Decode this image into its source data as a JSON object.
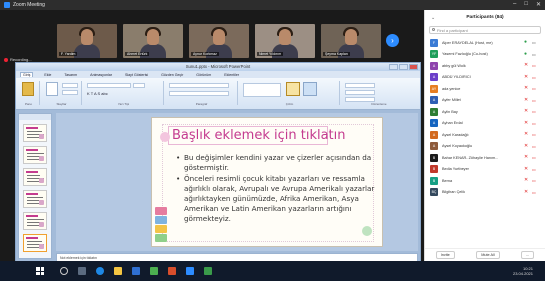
{
  "zoom": {
    "window_title": "Zoom Meeting",
    "recording_label": "Recording...",
    "video_tiles": [
      {
        "name": "F. Yardim",
        "bg": "#6d5a4a"
      },
      {
        "name": "Ahmet Ertürk",
        "bg": "#8a7d6c"
      },
      {
        "name": "Aynur Korkmaz",
        "bg": "#7b6a5b"
      },
      {
        "name": "Nimet Yıldırım",
        "bg": "#9c8f84"
      },
      {
        "name": "Şeyma Kaplan",
        "bg": "#6f6356"
      }
    ]
  },
  "ppt": {
    "window_title": "Sunu1.pptx - Microsoft PowerPoint",
    "tabs": [
      "Giriş",
      "Ekle",
      "Tasarım",
      "Animasyonlar",
      "Slayt Gösterisi",
      "Gözden Geçir",
      "Görünüm",
      "Eklentiler"
    ],
    "ribbon_groups": [
      "Pano",
      "Slaytlar",
      "Yazı Tipi",
      "Paragraf",
      "Çizim",
      "Düzenleme"
    ],
    "slide": {
      "title": "Başlık eklemek için tıklatın",
      "bullets": [
        "Bu değişimler kendini yazar ve çizerler açısından da göstermiştir.",
        "Önceleri resimli çocuk kitabı yazarları ve ressamla ağırlıklı olarak, Avrupalı ve Avrupa Amerikalı yazarlar ağırlıktayken günümüzde, Afrika Amerikan, Asya Amerikan ve Latin Amerikan yazarların artığını görmekteyiz."
      ]
    },
    "notes_placeholder": "Not eklemek için tıklatın",
    "status_text": "Slayt 12 / 12   \"Gradient\"   Türkçe"
  },
  "participants": {
    "header": "Participants (84)",
    "search_placeholder": "Find a participant",
    "list": [
      {
        "initials": "F",
        "name": "Alper ERAYDELAL (Host, me)",
        "color": "#3a7bd5"
      },
      {
        "initials": "YF",
        "name": "Yasemi Fazlıoğlu (Co-host)",
        "color": "#1e9e5a"
      },
      {
        "initials": "A",
        "name": "abby gül Wolk",
        "color": "#8e44ad"
      },
      {
        "initials": "A",
        "name": "ABDÜ YILDIRICI",
        "color": "#6c3fc9"
      },
      {
        "initials": "AY",
        "name": "ada yenice",
        "color": "#e67e22"
      },
      {
        "initials": "A",
        "name": "Ayfer Millet",
        "color": "#2f5fb3"
      },
      {
        "initials": "A",
        "name": "Aylin Bay",
        "color": "#2e7d32"
      },
      {
        "initials": "A",
        "name": "Ayhan Erdal",
        "color": "#1565c0"
      },
      {
        "initials": "A",
        "name": "Aysel Karadağlı",
        "color": "#d2691e"
      },
      {
        "initials": "A",
        "name": "Aysel Koyaokoğlu",
        "color": "#8d5a3b"
      },
      {
        "initials": "B",
        "name": "Bahar KENAR- Zöhaylie Hanım...",
        "color": "#1a1a1a"
      },
      {
        "initials": "B",
        "name": "Bedia Yurtbeyer",
        "color": "#c0392b"
      },
      {
        "initials": "B",
        "name": "Berna",
        "color": "#16a085"
      },
      {
        "initials": "BÇ",
        "name": "Bilgihan Çelik",
        "color": "#34495e"
      }
    ],
    "footer": {
      "invite": "Invite",
      "mute_all": "Mute All",
      "more": "..."
    }
  },
  "taskbar": {
    "time": "10:21",
    "date": "23.04.2021"
  }
}
